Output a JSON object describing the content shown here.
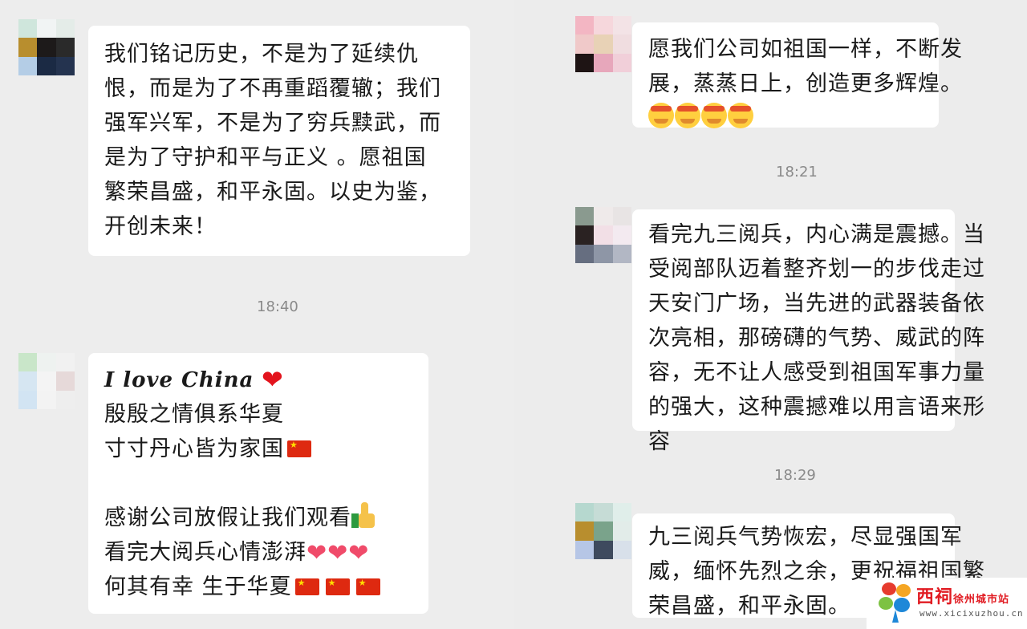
{
  "left": {
    "messages": [
      {
        "lines": [
          "我们铭记历史，不是为了延续仇",
          "恨，而是为了不再重蹈覆辙；我们",
          "强军兴军，不是为了穷兵黩武，而",
          "是为了守护和平与正义 。愿祖国",
          "繁荣昌盛，和平永固。以史为鉴，",
          "开创未来！"
        ]
      },
      {
        "time": "18:40",
        "title": "I love China",
        "lines": [
          "殷殷之情俱系华夏",
          "寸寸丹心皆为家国",
          "",
          "感谢公司放假让我们观看",
          "看完大阅兵心情澎湃",
          "何其有幸 生于华夏"
        ]
      }
    ]
  },
  "right": {
    "messages": [
      {
        "lines": [
          "愿我们公司如祖国一样，不断发",
          "展，蒸蒸日上，创造更多辉煌。"
        ]
      },
      {
        "time": "18:21",
        "lines": [
          "看完九三阅兵，内心满是震撼。当",
          "受阅部队迈着整齐划一的步伐走过",
          "天安门广场，当先进的武器装备依",
          "次亮相，那磅礴的气势、威武的阵",
          "容，无不让人感受到祖国军事力量",
          "的强大，这种震撼难以用言语来形",
          "容"
        ]
      },
      {
        "time": "18:29",
        "lines": [
          "九三阅兵气势恢宏，尽显强国军",
          "威，缅怀先烈之余，更祝福祖国繁",
          "荣昌盛，和平永固。"
        ]
      }
    ]
  },
  "watermark": {
    "brand": "西祠",
    "subtitle": "徐州城市站",
    "url": "www.xicixuzhou.cn"
  },
  "colors": {
    "background": "#ededed",
    "bubble": "#ffffff",
    "timestamp": "#8a8a8a",
    "brand_red": "#e11b22"
  },
  "icons": [
    "heart-emoji",
    "china-flag-emoji",
    "thumbs-up-emoji",
    "salute-face-emoji",
    "pink-heart-emoji",
    "xici-logo"
  ]
}
